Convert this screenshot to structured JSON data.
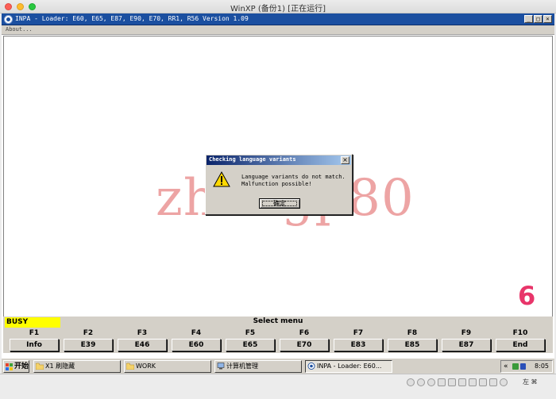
{
  "host": {
    "window_title": "WinXP (备份1) [正在运行]"
  },
  "inpa": {
    "title": "INPA - Loader:  E60, E65, E87, E90, E70, RR1, R56 Version 1.09",
    "menu_about": "About...",
    "window_buttons": [
      "_",
      "□",
      "×"
    ]
  },
  "overlay": {
    "watermark": "zhangp80",
    "badge": "6"
  },
  "dialog": {
    "title": "Checking language variants",
    "close": "×",
    "line1": "Language variants do not match.",
    "line2": "Malfunction possible!",
    "ok_label": "确定",
    "icon": "warning-icon"
  },
  "status": {
    "busy": "BUSY",
    "select_menu": "Select menu"
  },
  "fkeys": [
    {
      "key": "F1",
      "label": "Info"
    },
    {
      "key": "F2",
      "label": "E39"
    },
    {
      "key": "F3",
      "label": "E46"
    },
    {
      "key": "F4",
      "label": "E60"
    },
    {
      "key": "F5",
      "label": "E65"
    },
    {
      "key": "F6",
      "label": "E70"
    },
    {
      "key": "F7",
      "label": "E83"
    },
    {
      "key": "F8",
      "label": "E85"
    },
    {
      "key": "F9",
      "label": "E87"
    },
    {
      "key": "F10",
      "label": "End"
    }
  ],
  "taskbar": {
    "start": "开始",
    "tasks": [
      {
        "label": "X1 刷隐藏",
        "icon": "folder-icon"
      },
      {
        "label": "WORK",
        "icon": "folder-icon"
      },
      {
        "label": "计算机管理",
        "icon": "computer-icon"
      },
      {
        "label": "INPA - Loader:  E60...",
        "icon": "inpa-icon"
      }
    ],
    "tray_arrow": "«",
    "clock": "8:05"
  },
  "vm_bar": {
    "ime": "左 ⌘"
  },
  "colors": {
    "busy_bg": "#ffff00",
    "watermark": "#de5a5a",
    "badge": "#e8356a",
    "titlebar": "#1b4fa0"
  }
}
